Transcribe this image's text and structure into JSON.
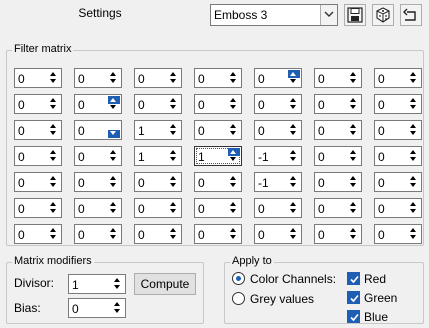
{
  "header": {
    "title": "Settings",
    "preset_value": "Emboss 3",
    "icons": [
      "save-icon",
      "dice-icon",
      "reset-icon"
    ]
  },
  "filter_matrix": {
    "label": "Filter matrix",
    "rows": [
      [
        "0",
        "0",
        "0",
        "0",
        "0",
        "0",
        "0"
      ],
      [
        "0",
        "0",
        "0",
        "0",
        "0",
        "0",
        "0"
      ],
      [
        "0",
        "0",
        "1",
        "0",
        "0",
        "0",
        "0"
      ],
      [
        "0",
        "0",
        "1",
        "1",
        "-1",
        "0",
        "0"
      ],
      [
        "0",
        "0",
        "0",
        "0",
        "-1",
        "0",
        "0"
      ],
      [
        "0",
        "0",
        "0",
        "0",
        "0",
        "0",
        "0"
      ],
      [
        "0",
        "0",
        "0",
        "0",
        "0",
        "0",
        "0"
      ]
    ]
  },
  "matrix_modifiers": {
    "label": "Matrix modifiers",
    "divisor_label": "Divisor:",
    "divisor_value": "1",
    "bias_label": "Bias:",
    "bias_value": "0",
    "compute_label": "Compute"
  },
  "apply_to": {
    "label": "Apply to",
    "color_channels_label": "Color Channels:",
    "grey_values_label": "Grey values",
    "red_label": "Red",
    "green_label": "Green",
    "blue_label": "Blue",
    "selected_mode": "Color Channels:",
    "channels_checked": {
      "red": true,
      "green": true,
      "blue": true
    }
  },
  "colors": {
    "accent": "#1e5fb4",
    "window_bg": "#f0f0f0",
    "border": "#7a7a7a"
  }
}
